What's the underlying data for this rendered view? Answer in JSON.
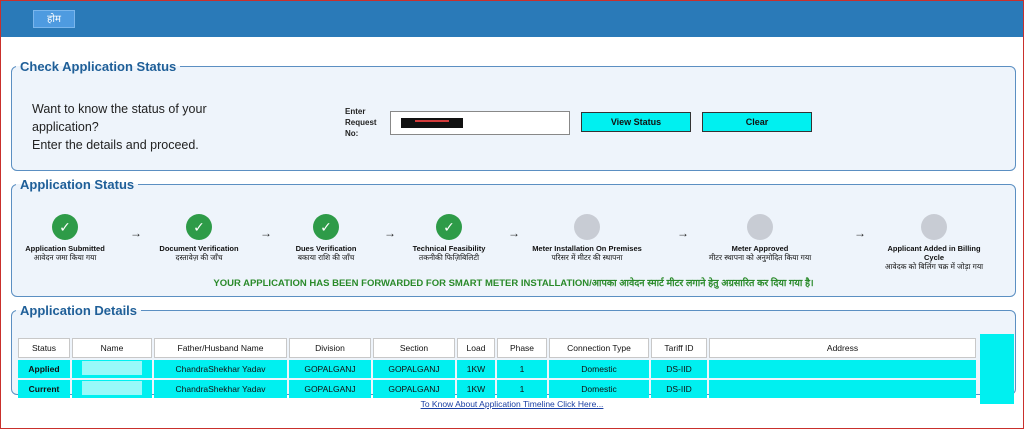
{
  "header": {
    "home_label": "होम"
  },
  "check": {
    "legend": "Check Application Status",
    "intro_line1": "Want to know the status of your application?",
    "intro_line2": "Enter the details and proceed.",
    "request_label": "Enter Request No:",
    "view_button": "View Status",
    "clear_button": "Clear"
  },
  "status": {
    "legend": "Application Status",
    "steps": [
      {
        "en": "Application Submitted",
        "hi": "आवेदन जमा किया गया",
        "done": true
      },
      {
        "en": "Document Verification",
        "hi": "दस्तावेज़ की जाँच",
        "done": true
      },
      {
        "en": "Dues Verification",
        "hi": "बकाया राशि की जाँच",
        "done": true
      },
      {
        "en": "Technical Feasibility",
        "hi": "तकनीकी फिज़िबिलिटी",
        "done": true
      },
      {
        "en": "Meter Installation On Premises",
        "hi": "परिसर में मीटर की स्थापना",
        "done": false
      },
      {
        "en": "Meter Approved",
        "hi": "मीटर स्थापना को अनुमोदित किया गया",
        "done": false
      },
      {
        "en": "Applicant Added in Billing Cycle",
        "hi": "आवेदक को बिलिंग चक्र में जोड़ा गया",
        "done": false
      }
    ],
    "forward_message": "YOUR APPLICATION HAS BEEN FORWARDED FOR SMART METER INSTALLATION/आपका आवेदन स्मार्ट मीटर लगाने हेतु अग्रसारित कर दिया गया है।",
    "check_glyph": "✓",
    "arrow_glyph": "→"
  },
  "details": {
    "legend": "Application Details",
    "columns": [
      "Status",
      "Name",
      "Father/Husband Name",
      "Division",
      "Section",
      "Load",
      "Phase",
      "Connection Type",
      "Tariff ID",
      "Address"
    ],
    "rows": [
      {
        "status": "Applied",
        "name": "",
        "father": "ChandraShekhar Yadav",
        "division": "GOPALGANJ",
        "section": "GOPALGANJ",
        "load": "1KW",
        "phase": "1",
        "connection": "Domestic",
        "tariff": "DS-IID",
        "address": ""
      },
      {
        "status": "Current",
        "name": "",
        "father": "ChandraShekhar Yadav",
        "division": "GOPALGANJ",
        "section": "GOPALGANJ",
        "load": "1KW",
        "phase": "1",
        "connection": "Domestic",
        "tariff": "DS-IID",
        "address": ""
      }
    ]
  },
  "footer": {
    "timeline_link": "To Know About Application Timeline Click Here..."
  }
}
